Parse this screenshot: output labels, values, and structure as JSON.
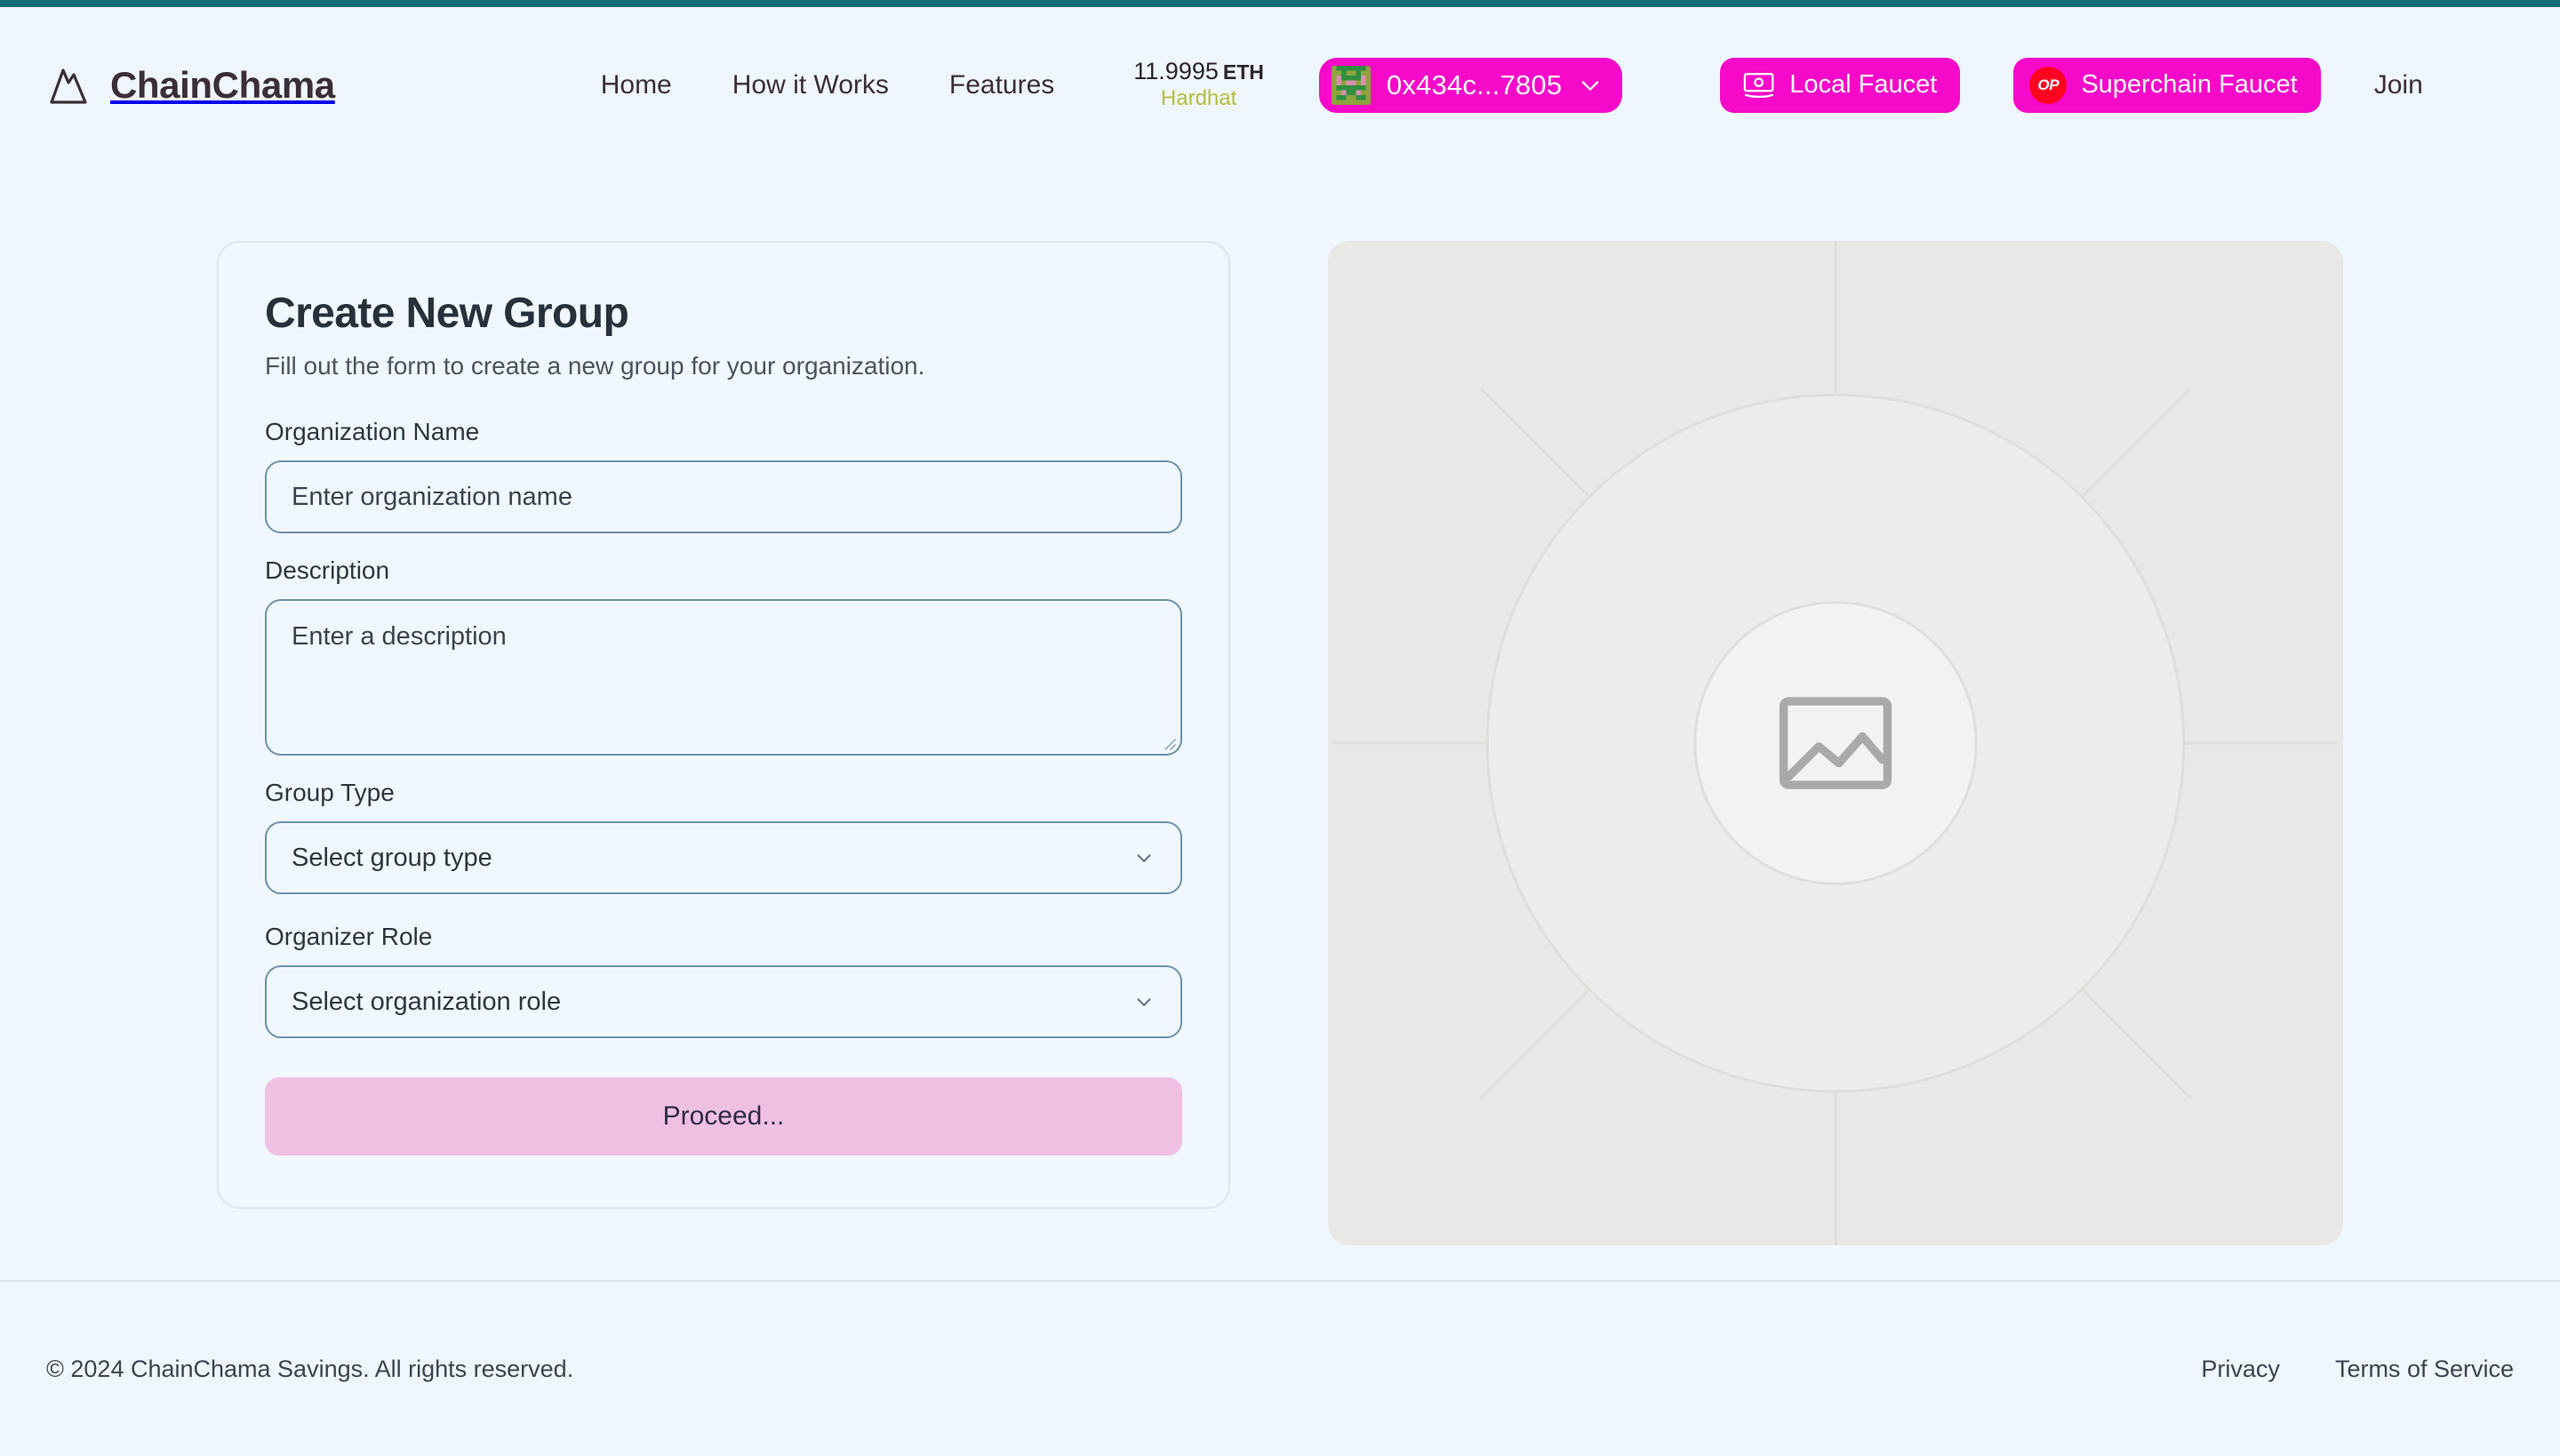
{
  "theme": {
    "accent_bar": "#0e6d77",
    "page_background": "#eff6fd",
    "brand_pink": "#f709c9",
    "op_red": "#ff0420",
    "proceed_pink": "#f0c0e3",
    "network_olive": "#b5bf3b",
    "input_border": "#6e90ae"
  },
  "header": {
    "brand": {
      "name": "ChainChama",
      "logo_icon": "mountain-icon"
    },
    "nav": [
      {
        "label": "Home"
      },
      {
        "label": "How it Works"
      },
      {
        "label": "Features"
      }
    ],
    "balance": {
      "amount": "11.9995",
      "unit": "ETH",
      "network": "Hardhat"
    },
    "wallet": {
      "address": "0x434c...7805",
      "avatar_icon": "identicon-avatar",
      "chevron_icon": "chevron-down-icon"
    },
    "local_faucet": {
      "label": "Local Faucet",
      "icon": "banknote-icon"
    },
    "superchain_faucet": {
      "label": "Superchain Faucet",
      "badge_text": "OP",
      "icon": "op-badge-icon"
    },
    "join": {
      "label": "Join"
    }
  },
  "form": {
    "title": "Create New Group",
    "subtitle": "Fill out the form to create a new group for your organization.",
    "organization_name": {
      "label": "Organization Name",
      "placeholder": "Enter organization name",
      "value": ""
    },
    "description": {
      "label": "Description",
      "placeholder": "Enter a description",
      "value": ""
    },
    "group_type": {
      "label": "Group Type",
      "placeholder": "Select group type",
      "value": "Select group type"
    },
    "organizer_role": {
      "label": "Organizer Role",
      "placeholder": "Select organization role",
      "value": "Select organization role"
    },
    "submit": {
      "label": "Proceed..."
    }
  },
  "image_panel": {
    "icon": "broken-image-placeholder-icon"
  },
  "footer": {
    "copyright": "© 2024 ChainChama Savings. All rights reserved.",
    "links": [
      {
        "label": "Privacy"
      },
      {
        "label": "Terms of Service"
      }
    ]
  }
}
